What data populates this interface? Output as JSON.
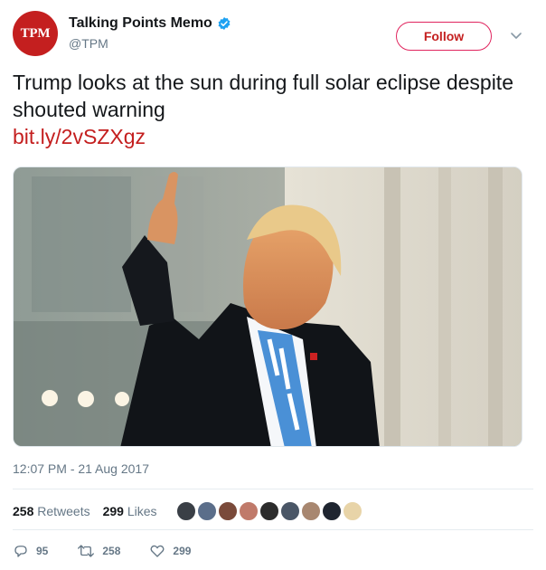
{
  "account": {
    "avatar_text": "TPM",
    "display_name": "Talking Points Memo",
    "handle": "@TPM",
    "verified": true
  },
  "follow_label": "Follow",
  "tweet": {
    "text": "Trump looks at the sun during full solar eclipse despite shouted warning",
    "link": "bit.ly/2vSZXgz"
  },
  "timestamp": "12:07 PM - 21 Aug 2017",
  "stats": {
    "retweets_count": "258",
    "retweets_label": "Retweets",
    "likes_count": "299",
    "likes_label": "Likes"
  },
  "actions": {
    "reply_count": "95",
    "retweet_count": "258",
    "like_count": "299"
  },
  "colors": {
    "brand": "#c41f1f",
    "verified": "#1da1f2",
    "muted": "#657786"
  },
  "icons": [
    "verified-badge-icon",
    "chevron-down-icon",
    "reply-icon",
    "retweet-icon",
    "heart-icon"
  ]
}
